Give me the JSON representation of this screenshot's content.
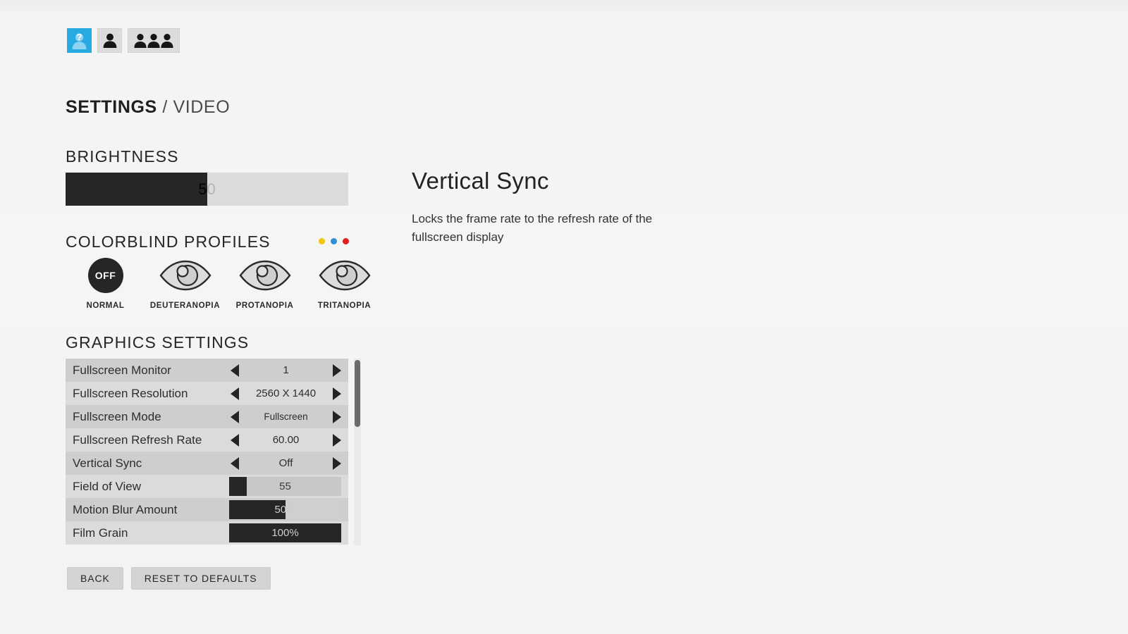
{
  "profile_bar": {
    "buttons": [
      {
        "name": "profile-unknown-button",
        "icon": "person-question-icon",
        "state": "active"
      },
      {
        "name": "profile-single-button",
        "icon": "person-icon",
        "state": "inactive"
      },
      {
        "name": "profile-group-button",
        "icon": "people-group-icon",
        "state": "inactive"
      }
    ]
  },
  "breadcrumb": {
    "primary": "SETTINGS",
    "separator": " / ",
    "secondary": "VIDEO"
  },
  "brightness": {
    "title": "BRIGHTNESS",
    "value_label": "50",
    "value": 50,
    "fill_percent": 50
  },
  "colorblind": {
    "title": "COLORBLIND PROFILES",
    "dots": [
      "#f2c613",
      "#2e8fd6",
      "#e02020"
    ],
    "options": [
      {
        "label": "NORMAL",
        "glyph": "OFF",
        "type": "off",
        "selected": true
      },
      {
        "label": "DEUTERANOPIA",
        "glyph": "",
        "type": "eye",
        "selected": false
      },
      {
        "label": "PROTANOPIA",
        "glyph": "",
        "type": "eye",
        "selected": false
      },
      {
        "label": "TRITANOPIA",
        "glyph": "",
        "type": "eye",
        "selected": false
      }
    ]
  },
  "graphics": {
    "title": "GRAPHICS SETTINGS",
    "rows": [
      {
        "label": "Fullscreen Monitor",
        "control": "stepper",
        "value": "1"
      },
      {
        "label": "Fullscreen Resolution",
        "control": "stepper",
        "value": "2560 X 1440"
      },
      {
        "label": "Fullscreen Mode",
        "control": "stepper",
        "value": "Fullscreen",
        "small": true
      },
      {
        "label": "Fullscreen Refresh Rate",
        "control": "stepper",
        "value": "60.00"
      },
      {
        "label": "Vertical Sync",
        "control": "stepper",
        "value": "Off",
        "selected": true
      },
      {
        "label": "Field of View",
        "control": "slider",
        "value": "55",
        "fill_percent": 16
      },
      {
        "label": "Motion Blur Amount",
        "control": "slider",
        "value": "50%",
        "fill_percent": 50
      },
      {
        "label": "Film Grain",
        "control": "slider",
        "value": "100%",
        "fill_percent": 100
      }
    ],
    "scroll_position": "top"
  },
  "buttons": {
    "back": "BACK",
    "reset": "RESET TO DEFAULTS"
  },
  "description": {
    "title": "Vertical Sync",
    "body": "Locks the frame rate to the refresh rate of the fullscreen display"
  },
  "colors": {
    "accent_blue": "#27a9e1",
    "fill_dark": "#272525",
    "row_odd": "#cecece",
    "row_even": "#dbdbdb",
    "background": "#f4f4f3"
  }
}
